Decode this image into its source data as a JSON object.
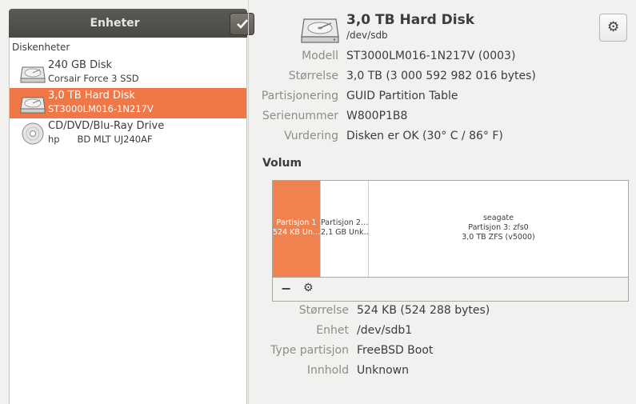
{
  "sidebar": {
    "title": "Enheter",
    "group_label": "Diskenheter",
    "items": [
      {
        "name": "240 GB Disk",
        "sub": "Corsair Force 3 SSD",
        "icon": "hard-disk-icon"
      },
      {
        "name": "3,0 TB Hard Disk",
        "sub": "ST3000LM016-1N217V",
        "icon": "hard-disk-icon",
        "selected": true
      },
      {
        "name": "CD/DVD/Blu-Ray Drive",
        "sub": "hp      BD MLT UJ240AF",
        "icon": "optical-disc-icon"
      }
    ]
  },
  "disk": {
    "title": "3,0 TB Hard Disk",
    "device": "/dev/sdb",
    "props": [
      {
        "key": "Modell",
        "value": "ST3000LM016-1N217V (0003)"
      },
      {
        "key": "Størrelse",
        "value": "3,0 TB (3 000 592 982 016 bytes)"
      },
      {
        "key": "Partisjonering",
        "value": "GUID Partition Table"
      },
      {
        "key": "Serienummer",
        "value": "W800P1B8"
      },
      {
        "key": "Vurdering",
        "value": "Disken er OK (30° C / 86° F)"
      }
    ]
  },
  "volume": {
    "label": "Volum",
    "partitions": [
      {
        "line1": "Partisjon 1",
        "line2": "524 KB Un…",
        "selected": true
      },
      {
        "line1": "Partisjon 2…",
        "line2": "2,1 GB Unk…"
      },
      {
        "line0": "seagate",
        "line1": "Partisjon 3: zfs0",
        "line2": "3,0 TB ZFS (v5000)"
      }
    ],
    "minus_label": "−",
    "gear_label": "⚙"
  },
  "partition_props": [
    {
      "key": "Størrelse",
      "value": "524 KB (524 288 bytes)"
    },
    {
      "key": "Enhet",
      "value": "/dev/sdb1"
    },
    {
      "key": "Type partisjon",
      "value": "FreeBSD Boot"
    },
    {
      "key": "Innhold",
      "value": "Unknown"
    }
  ],
  "colors": {
    "accent": "#f07746",
    "header": "#4f4e4a"
  }
}
